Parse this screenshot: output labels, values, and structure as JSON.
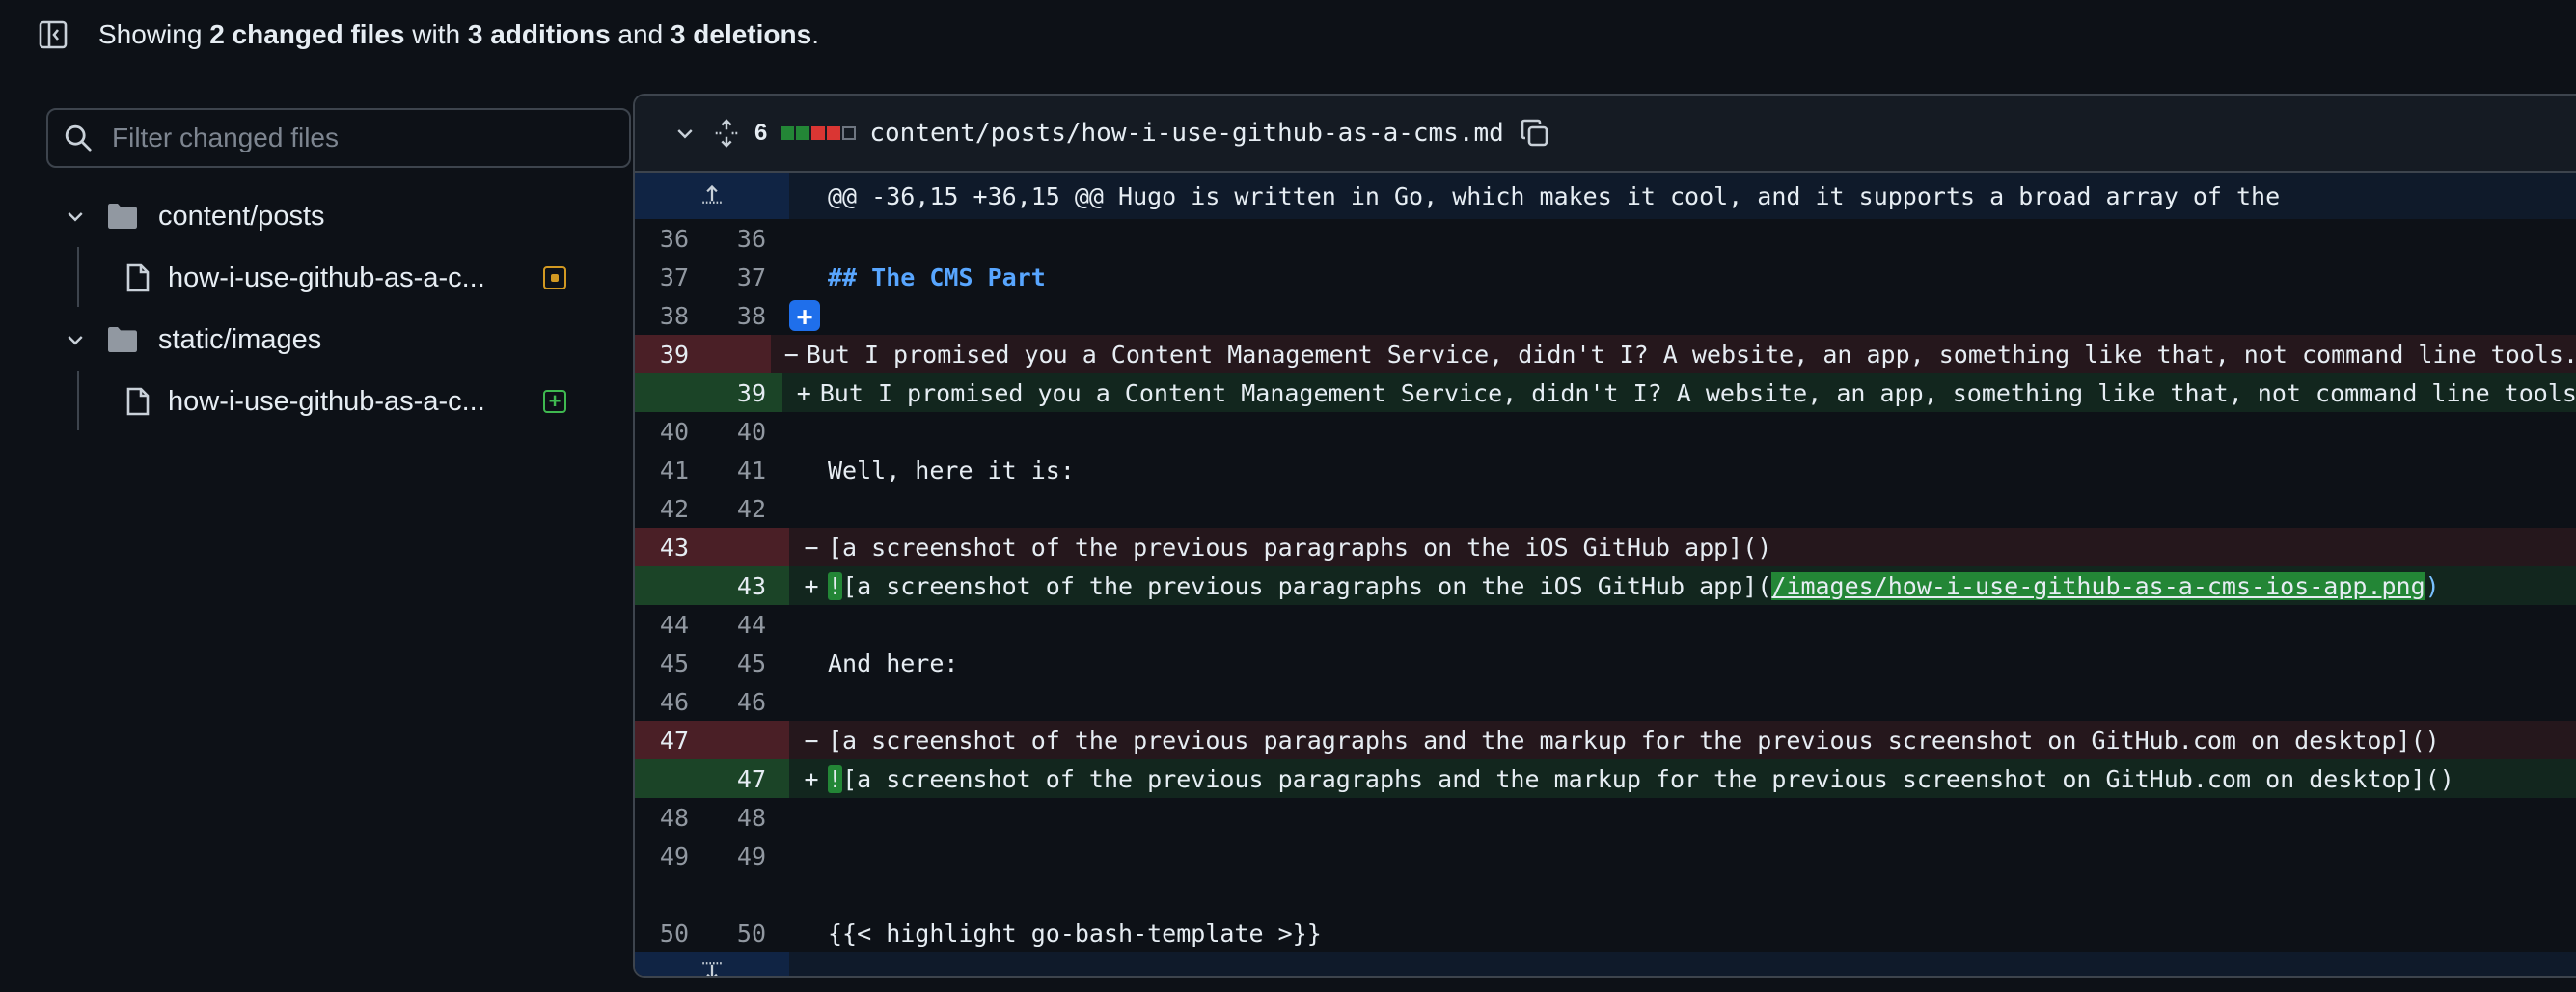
{
  "summary": {
    "prefix": "Showing ",
    "files": "2 changed files",
    "mid1": " with ",
    "additions": "3 additions",
    "mid2": " and ",
    "deletions": "3 deletions",
    "suffix": "."
  },
  "filter": {
    "placeholder": "Filter changed files"
  },
  "tree": {
    "folders": [
      {
        "name": "content/posts",
        "file": "how-i-use-github-as-a-c...",
        "status": "modified"
      },
      {
        "name": "static/images",
        "file": "how-i-use-github-as-a-c...",
        "status": "added"
      }
    ]
  },
  "diff": {
    "changes": "6",
    "path": "content/posts/how-i-use-github-as-a-cms.md",
    "hunk_header": "@@ -36,15 +36,15 @@ Hugo is written in Go, which makes it cool, and it supports a broad array of the",
    "colors": {
      "add": "#238636",
      "del": "#da3633",
      "neutral": "#6e7681"
    },
    "lines": [
      {
        "type": "ctx",
        "old": "36",
        "new": "36",
        "text": ""
      },
      {
        "type": "ctx",
        "old": "37",
        "new": "37",
        "text": "## The CMS Part"
      },
      {
        "type": "ctx",
        "old": "38",
        "new": "38",
        "text": ""
      },
      {
        "type": "del",
        "old": "39",
        "new": "",
        "text": "But I promised you a Content Management Service, didn't I? A website, an app, something like that, not command line tools."
      },
      {
        "type": "add",
        "old": "",
        "new": "39",
        "text": "But I promised you a Content Management Service, didn't I? A website, an app, something like that, not command line tools."
      },
      {
        "type": "ctx",
        "old": "40",
        "new": "40",
        "text": ""
      },
      {
        "type": "ctx",
        "old": "41",
        "new": "41",
        "text": "Well, here it is:"
      },
      {
        "type": "ctx",
        "old": "42",
        "new": "42",
        "text": ""
      },
      {
        "type": "del",
        "old": "43",
        "new": "",
        "text": "[a screenshot of the previous paragraphs on the iOS GitHub app]()"
      },
      {
        "type": "add",
        "old": "",
        "new": "43",
        "text_bang": "!",
        "text": "[a screenshot of the previous paragraphs on the iOS GitHub app](",
        "link": "/images/how-i-use-github-as-a-cms-ios-app.png",
        "tail": ")"
      },
      {
        "type": "ctx",
        "old": "44",
        "new": "44",
        "text": ""
      },
      {
        "type": "ctx",
        "old": "45",
        "new": "45",
        "text": "And here:"
      },
      {
        "type": "ctx",
        "old": "46",
        "new": "46",
        "text": ""
      },
      {
        "type": "del",
        "old": "47",
        "new": "",
        "text": "[a screenshot of the previous paragraphs and the markup for the previous screenshot on GitHub.com on desktop]()"
      },
      {
        "type": "add",
        "old": "",
        "new": "47",
        "text_bang": "!",
        "text": "[a screenshot of the previous paragraphs and the markup for the previous screenshot on GitHub.com on desktop]()"
      },
      {
        "type": "ctx",
        "old": "48",
        "new": "48",
        "text": ""
      },
      {
        "type": "ctx",
        "old": "49",
        "new": "49",
        "text": ""
      },
      {
        "type": "ctx",
        "old": "50",
        "new": "50",
        "text": "{{< highlight go-bash-template >}}"
      }
    ]
  }
}
